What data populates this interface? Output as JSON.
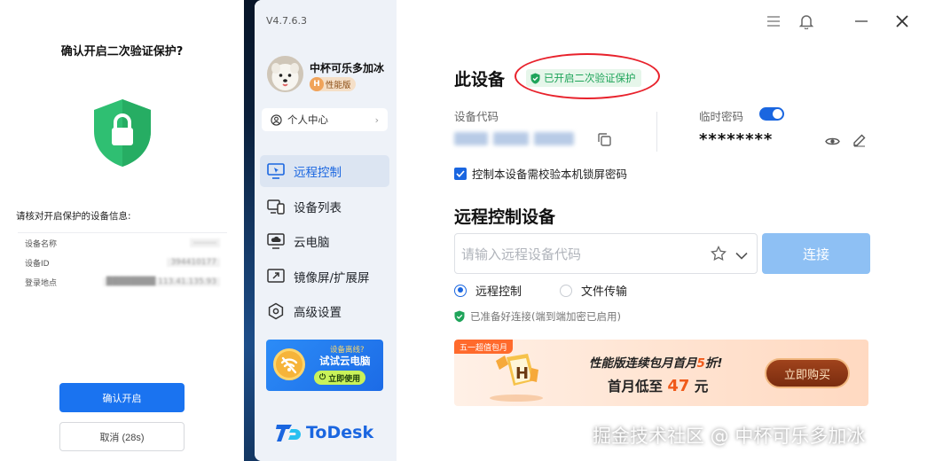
{
  "mobile": {
    "title": "确认开启二次验证保护?",
    "verify_title": "请核对开启保护的设备信息:",
    "info": [
      {
        "label": "设备名称",
        "value": "--------"
      },
      {
        "label": "设备ID",
        "value": "394410177"
      },
      {
        "label": "登录地点",
        "value": "████████ 113.41.135.93"
      }
    ],
    "confirm_label": "确认开启",
    "cancel_label": "取消 (28s)"
  },
  "app": {
    "version": "V4.7.6.3",
    "user": {
      "name": "中杯可乐多加冰",
      "plan_badge": "H",
      "plan": "性能版"
    },
    "personal_center": "个人中心",
    "nav": [
      {
        "label": "远程控制",
        "icon": "remote-control-icon",
        "active": true
      },
      {
        "label": "设备列表",
        "icon": "device-list-icon",
        "active": false
      },
      {
        "label": "云电脑",
        "icon": "cloud-pc-icon",
        "active": false
      },
      {
        "label": "镜像屏/扩展屏",
        "icon": "mirror-screen-icon",
        "active": false
      },
      {
        "label": "高级设置",
        "icon": "settings-icon",
        "active": false
      }
    ],
    "promo": {
      "line1": "设备离线?",
      "line2": "试试云电脑",
      "button": "立即使用"
    },
    "logo_text": "ToDesk"
  },
  "main": {
    "device_title": "此设备",
    "protect_badge": "已开启二次验证保护",
    "device_code_label": "设备代码",
    "temp_password_label": "临时密码",
    "temp_password_toggle": true,
    "temp_password": "********",
    "lock_screen_check": "控制本设备需校验本机锁屏密码",
    "lock_screen_checked": true,
    "remote_title": "远程控制设备",
    "remote_placeholder": "请输入远程设备代码",
    "connect_label": "连接",
    "modes": [
      {
        "label": "远程控制",
        "selected": true
      },
      {
        "label": "文件传输",
        "selected": false
      }
    ],
    "ready_text": "已准备好连接(端到端加密已启用)",
    "banner": {
      "tag": "五一超值包月",
      "line1_pre": "性能版连续包月首月",
      "line1_hl": "5",
      "line1_post": "折!",
      "line2_pre": "首月低至 ",
      "line2_hl": "47",
      "line2_post": " 元",
      "buy_label": "立即购买"
    }
  },
  "watermark": "掘金技术社区 @ 中杯可乐多加冰",
  "colors": {
    "accent": "#1a66e0",
    "success": "#1fa45a",
    "highlight": "#e8222c",
    "promo_orange": "#f05a1a"
  }
}
